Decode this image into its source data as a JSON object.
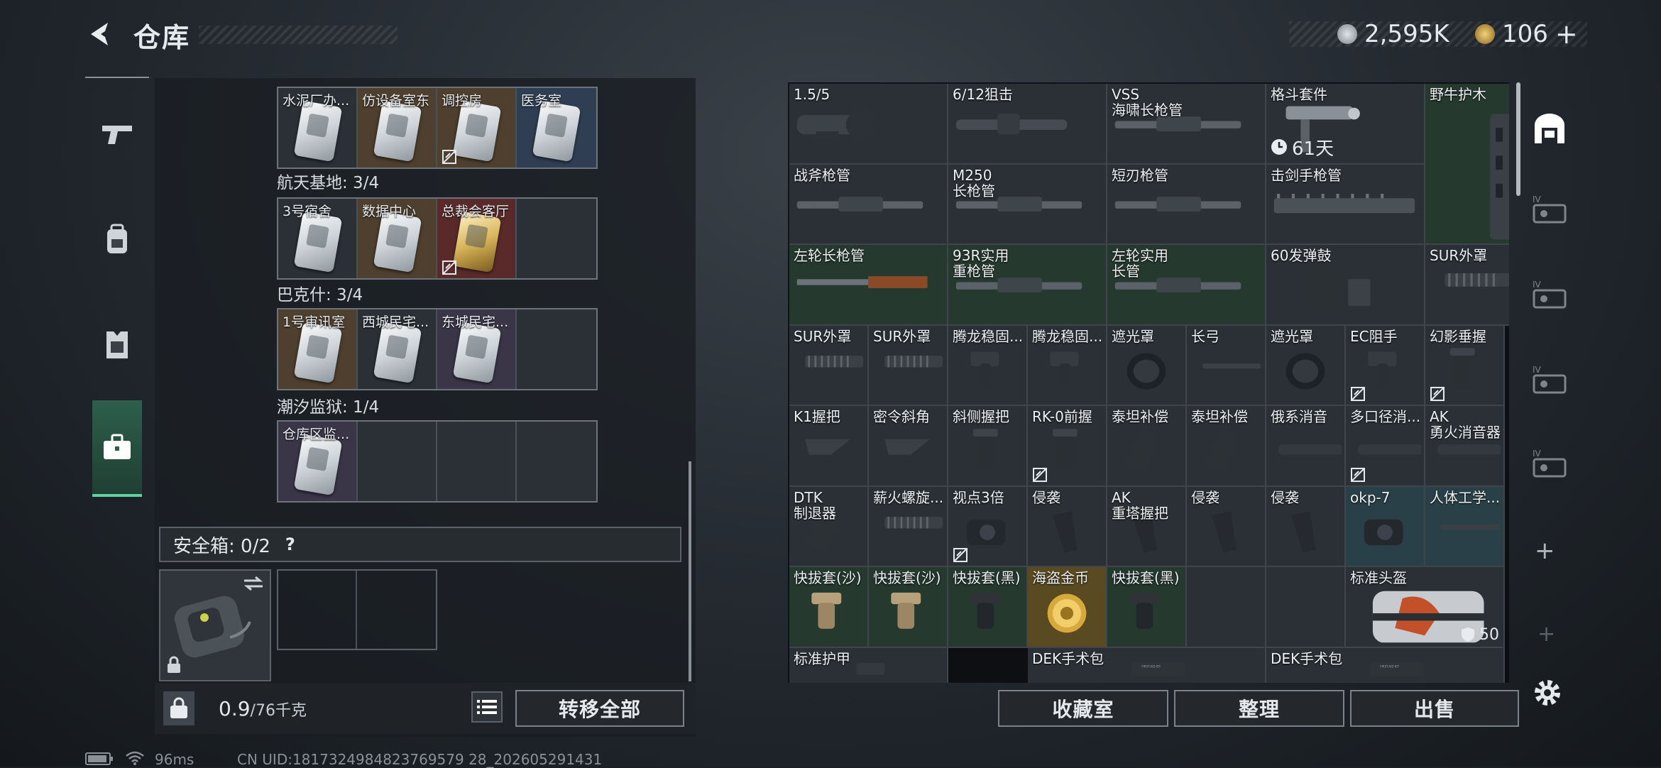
{
  "header": {
    "title": "仓库"
  },
  "currency": [
    {
      "icon": "coin-silver-icon",
      "value": "2,595K",
      "color": "#b8bec4"
    },
    {
      "icon": "coin-gold-icon",
      "value": "106",
      "color": "#c9a24a"
    }
  ],
  "nav": [
    "weapon-tab",
    "backpack-tab",
    "armor-tab",
    "storage-tab"
  ],
  "left": {
    "top_row": [
      {
        "name": "水泥厂办...",
        "bg": "bg-dark",
        "gold": false,
        "bound": false
      },
      {
        "name": "仿设备室东",
        "bg": "bg-brown",
        "gold": false,
        "bound": false
      },
      {
        "name": "调控房",
        "bg": "bg-brown",
        "gold": false,
        "bound": true
      },
      {
        "name": "医务室",
        "bg": "bg-blue",
        "gold": false,
        "bound": false
      }
    ],
    "groups": [
      {
        "label": "航天基地: 3/4",
        "cards": [
          {
            "name": "3号宿舍",
            "bg": "bg-dark",
            "gold": false,
            "bound": false
          },
          {
            "name": "数据中心",
            "bg": "bg-brown",
            "gold": false,
            "bound": false
          },
          {
            "name": "总裁会客厅",
            "bg": "bg-red",
            "gold": true,
            "bound": true
          },
          {
            "name": "",
            "bg": "bg-dark",
            "empty": true
          }
        ]
      },
      {
        "label": "巴克什: 3/4",
        "cards": [
          {
            "name": "1号审讯室",
            "bg": "bg-brown",
            "gold": false,
            "bound": false
          },
          {
            "name": "西城民宅...",
            "bg": "bg-dark",
            "gold": false,
            "bound": false
          },
          {
            "name": "东城民宅...",
            "bg": "bg-purple",
            "gold": false,
            "bound": false
          },
          {
            "name": "",
            "bg": "bg-dark",
            "empty": true
          }
        ]
      },
      {
        "label": "潮汐监狱: 1/4",
        "cards": [
          {
            "name": "仓库区监...",
            "bg": "bg-purple",
            "gold": false,
            "bound": false
          },
          {
            "name": "",
            "bg": "bg-dark",
            "empty": true
          },
          {
            "name": "",
            "bg": "bg-dark",
            "empty": true
          },
          {
            "name": "",
            "bg": "bg-dark",
            "empty": true
          }
        ]
      }
    ],
    "safe_label": "安全箱: 0/2",
    "help": "?",
    "weight_current": "0.9",
    "weight_max": "/76千克",
    "transfer_all": "转移全部"
  },
  "buttons": {
    "collection": "收藏室",
    "sort": "整理",
    "sell": "出售"
  },
  "grid": {
    "items": [
      {
        "n": "1.5/5",
        "c": 0,
        "r": 0,
        "w": 1,
        "h": 1,
        "bg": "bg-dark",
        "shape": "scope"
      },
      {
        "n": "6/12狙击",
        "c": 1,
        "r": 0,
        "w": 1,
        "h": 1,
        "bg": "bg-dark",
        "shape": "longscope"
      },
      {
        "n": "VSS\n海啸长枪管",
        "c": 2,
        "r": 0,
        "w": 1,
        "h": 1,
        "bg": "bg-dark",
        "shape": "barrel"
      },
      {
        "n": "格斗套件",
        "c": 3,
        "r": 0,
        "w": 1,
        "h": 1,
        "bg": "bg-dark",
        "shape": "kit",
        "timer": "61天"
      },
      {
        "n": "野牛护木",
        "c": 4,
        "r": 0,
        "w": 1,
        "h": 2,
        "bg": "bg-green",
        "shape": "handguard"
      },
      {
        "n": "战斧枪管",
        "c": 0,
        "r": 1,
        "w": 1,
        "h": 1,
        "bg": "bg-dark",
        "shape": "barrel"
      },
      {
        "n": "M250\n长枪管",
        "c": 1,
        "r": 1,
        "w": 1,
        "h": 1,
        "bg": "bg-dark",
        "shape": "barrel"
      },
      {
        "n": "短刃枪管",
        "c": 2,
        "r": 1,
        "w": 1,
        "h": 1,
        "bg": "bg-dark",
        "shape": "barrel"
      },
      {
        "n": "击剑手枪管",
        "c": 3,
        "r": 1,
        "w": 1,
        "h": 1,
        "bg": "bg-dark",
        "shape": "rail"
      },
      {
        "n": "左轮长枪管",
        "c": 0,
        "r": 2,
        "w": 1,
        "h": 1,
        "bg": "bg-green",
        "shape": "wood"
      },
      {
        "n": "93R实用\n重枪管",
        "c": 1,
        "r": 2,
        "w": 1,
        "h": 1,
        "bg": "bg-green",
        "shape": "barrel"
      },
      {
        "n": "左轮实用\n长管",
        "c": 2,
        "r": 2,
        "w": 1,
        "h": 1,
        "bg": "bg-green",
        "shape": "barrel"
      },
      {
        "n": "60发弹鼓",
        "c": 3,
        "r": 2,
        "w": 1,
        "h": 1,
        "bg": "bg-dark",
        "shape": "drum"
      },
      {
        "n": "SUR外罩",
        "c": 4,
        "r": 2,
        "w": 1,
        "h": 1,
        "bg": "bg-dark",
        "shape": "muzzle"
      },
      {
        "n": "SUR外罩",
        "c": 0,
        "r": 3,
        "w": 0.5,
        "h": 1,
        "bg": "bg-dark",
        "shape": "muzzle"
      },
      {
        "n": "SUR外罩",
        "c": 0.5,
        "r": 3,
        "w": 0.5,
        "h": 1,
        "bg": "bg-dark",
        "shape": "muzzle"
      },
      {
        "n": "腾龙稳固...",
        "c": 1,
        "r": 3,
        "w": 0.5,
        "h": 1,
        "bg": "bg-dark",
        "shape": "grip"
      },
      {
        "n": "腾龙稳固...",
        "c": 1.5,
        "r": 3,
        "w": 0.5,
        "h": 1,
        "bg": "bg-dark",
        "shape": "grip"
      },
      {
        "n": "遮光罩",
        "c": 2,
        "r": 3,
        "w": 0.5,
        "h": 1,
        "bg": "bg-dark",
        "shape": "shade"
      },
      {
        "n": "长弓",
        "c": 2.5,
        "r": 3,
        "w": 0.5,
        "h": 1,
        "bg": "bg-dark",
        "shape": "thin"
      },
      {
        "n": "遮光罩",
        "c": 3,
        "r": 3,
        "w": 0.5,
        "h": 1,
        "bg": "bg-dark",
        "shape": "shade"
      },
      {
        "n": "EC阻手",
        "c": 3.5,
        "r": 3,
        "w": 0.5,
        "h": 1,
        "bg": "bg-dark",
        "shape": "grip",
        "bound": true
      },
      {
        "n": "幻影垂握",
        "c": 4,
        "r": 3,
        "w": 0.5,
        "h": 1,
        "bg": "bg-dark",
        "shape": "vgrip",
        "bound": true
      },
      {
        "n": "K1握把",
        "c": 0,
        "r": 4,
        "w": 0.5,
        "h": 1,
        "bg": "bg-dark",
        "shape": "angled"
      },
      {
        "n": "密令斜角",
        "c": 0.5,
        "r": 4,
        "w": 0.5,
        "h": 1,
        "bg": "bg-dark",
        "shape": "angled"
      },
      {
        "n": "斜侧握把",
        "c": 1,
        "r": 4,
        "w": 0.5,
        "h": 1,
        "bg": "bg-dark",
        "shape": "vgrip"
      },
      {
        "n": "RK-0前握",
        "c": 1.5,
        "r": 4,
        "w": 0.5,
        "h": 1,
        "bg": "bg-dark",
        "shape": "vgrip",
        "bound": true
      },
      {
        "n": "泰坦补偿",
        "c": 2,
        "r": 4,
        "w": 0.5,
        "h": 1,
        "bg": "bg-dark",
        "shape": "comp"
      },
      {
        "n": "泰坦补偿",
        "c": 2.5,
        "r": 4,
        "w": 0.5,
        "h": 1,
        "bg": "bg-dark",
        "shape": "comp"
      },
      {
        "n": "俄系消音",
        "c": 3,
        "r": 4,
        "w": 0.5,
        "h": 1,
        "bg": "bg-dark",
        "shape": "supp"
      },
      {
        "n": "多口径消...",
        "c": 3.5,
        "r": 4,
        "w": 0.5,
        "h": 1,
        "bg": "bg-dark",
        "shape": "supp",
        "bound": true
      },
      {
        "n": "AK\n勇火消音器",
        "c": 4,
        "r": 4,
        "w": 0.5,
        "h": 1,
        "bg": "bg-dark",
        "shape": "supp"
      },
      {
        "n": "DTK\n制退器",
        "c": 0,
        "r": 5,
        "w": 0.5,
        "h": 1,
        "bg": "bg-dark",
        "shape": "comp"
      },
      {
        "n": "薪火螺旋...",
        "c": 0.5,
        "r": 5,
        "w": 0.5,
        "h": 1,
        "bg": "bg-dark",
        "shape": "muzzle"
      },
      {
        "n": "视点3倍",
        "c": 1,
        "r": 5,
        "w": 0.5,
        "h": 1,
        "bg": "bg-dark",
        "shape": "optic",
        "bound": true
      },
      {
        "n": "侵袭",
        "c": 1.5,
        "r": 5,
        "w": 0.5,
        "h": 1,
        "bg": "bg-dark",
        "shape": "pgrip"
      },
      {
        "n": "AK\n重塔握把",
        "c": 2,
        "r": 5,
        "w": 0.5,
        "h": 1,
        "bg": "bg-dark",
        "shape": "pgrip"
      },
      {
        "n": "侵袭",
        "c": 2.5,
        "r": 5,
        "w": 0.5,
        "h": 1,
        "bg": "bg-dark",
        "shape": "pgrip"
      },
      {
        "n": "侵袭",
        "c": 3,
        "r": 5,
        "w": 0.5,
        "h": 1,
        "bg": "bg-dark",
        "shape": "pgrip"
      },
      {
        "n": "okp-7",
        "c": 3.5,
        "r": 5,
        "w": 0.5,
        "h": 1,
        "bg": "bg-teal",
        "shape": "optic"
      },
      {
        "n": "人体工学...",
        "c": 4,
        "r": 5,
        "w": 0.5,
        "h": 1,
        "bg": "bg-teal",
        "shape": "thin"
      },
      {
        "n": "快拔套(沙)",
        "c": 0,
        "r": 6,
        "w": 0.5,
        "h": 1,
        "bg": "bg-green",
        "shape": "mag"
      },
      {
        "n": "快拔套(沙)",
        "c": 0.5,
        "r": 6,
        "w": 0.5,
        "h": 1,
        "bg": "bg-green",
        "shape": "mag"
      },
      {
        "n": "快拔套(黑)",
        "c": 1,
        "r": 6,
        "w": 0.5,
        "h": 1,
        "bg": "bg-green",
        "shape": "magb"
      },
      {
        "n": "海盗金币",
        "c": 1.5,
        "r": 6,
        "w": 0.5,
        "h": 1,
        "bg": "bg-gold",
        "shape": "coin"
      },
      {
        "n": "快拔套(黑)",
        "c": 2,
        "r": 6,
        "w": 0.5,
        "h": 1,
        "bg": "bg-green",
        "shape": "magb"
      },
      {
        "n": "",
        "c": 2.5,
        "r": 6,
        "w": 0.5,
        "h": 1,
        "bg": "bg-dark",
        "shape": "none"
      },
      {
        "n": "",
        "c": 3,
        "r": 6,
        "w": 0.5,
        "h": 1,
        "bg": "bg-dark",
        "shape": "none"
      },
      {
        "n": "标准头盔",
        "c": 3.5,
        "r": 6,
        "w": 1,
        "h": 1,
        "bg": "bg-dark",
        "shape": "bag",
        "dur": "50"
      },
      {
        "n": "标准护甲",
        "c": 0,
        "r": 7,
        "w": 1,
        "h": 0.5,
        "bg": "bg-dark",
        "shape": "armor"
      },
      {
        "n": "DEK手术包",
        "c": 1.5,
        "r": 7,
        "w": 1.5,
        "h": 0.5,
        "bg": "bg-dark",
        "shape": "case"
      },
      {
        "n": "DEK手术包",
        "c": 3,
        "r": 7,
        "w": 1.5,
        "h": 0.5,
        "bg": "bg-dark",
        "shape": "case"
      }
    ]
  },
  "status": {
    "ping": "96ms",
    "uid": "CN UID:1817324984823769579 28_202605291431"
  }
}
